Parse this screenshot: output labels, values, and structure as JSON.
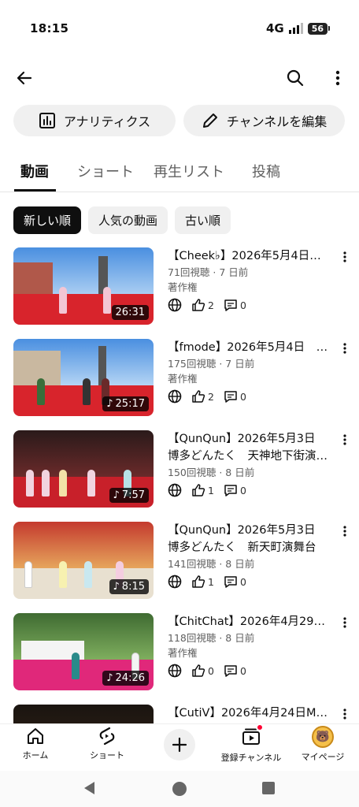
{
  "status_bar": {
    "time": "18:15",
    "network": "4G",
    "battery": "56"
  },
  "actions": {
    "analytics_label": "アナリティクス",
    "edit_channel_label": "チャンネルを編集"
  },
  "tabs": [
    {
      "label": "動画",
      "active": true
    },
    {
      "label": "ショート",
      "active": false
    },
    {
      "label": "再生リスト",
      "active": false
    },
    {
      "label": "投稿",
      "active": false
    }
  ],
  "sort_chips": [
    {
      "label": "新しい順",
      "active": true
    },
    {
      "label": "人気の動画",
      "active": false
    },
    {
      "label": "古い順",
      "active": false
    }
  ],
  "videos": [
    {
      "title": "【Cheek♭】2026年5月4日…",
      "meta": "71回視聴 · 7 日前",
      "extra": "著作権",
      "likes": "2",
      "comments": "0",
      "duration": "26:31",
      "music": false
    },
    {
      "title": "【fmode】2026年5月4日　…",
      "meta": "175回視聴 · 7 日前",
      "extra": "著作権",
      "likes": "2",
      "comments": "0",
      "duration": "25:17",
      "music": true
    },
    {
      "title": "【QunQun】2026年5月3日 博多どんたく　天神地下街演…",
      "meta": "150回視聴 · 8 日前",
      "extra": "",
      "likes": "1",
      "comments": "0",
      "duration": "7:57",
      "music": true
    },
    {
      "title": "【QunQun】2026年5月3日 博多どんたく　新天町演舞台",
      "meta": "141回視聴 · 8 日前",
      "extra": "",
      "likes": "1",
      "comments": "0",
      "duration": "8:15",
      "music": true
    },
    {
      "title": "【ChitChat】2026年4月29日…",
      "meta": "118回視聴 · 8 日前",
      "extra": "著作権",
      "likes": "0",
      "comments": "0",
      "duration": "24:26",
      "music": true
    },
    {
      "title": "【CutiV】2026年4月24日M…",
      "meta": "",
      "extra": "",
      "likes": "",
      "comments": "",
      "duration": "",
      "music": false
    }
  ],
  "bottom_nav": {
    "home": "ホーム",
    "shorts": "ショート",
    "subscriptions": "登録チャンネル",
    "you": "マイページ"
  },
  "colors": {
    "accent": "#0f0f0f",
    "chip_bg": "#f0f0f0",
    "notification": "#ff0033",
    "stage_red": "#d8242c"
  }
}
